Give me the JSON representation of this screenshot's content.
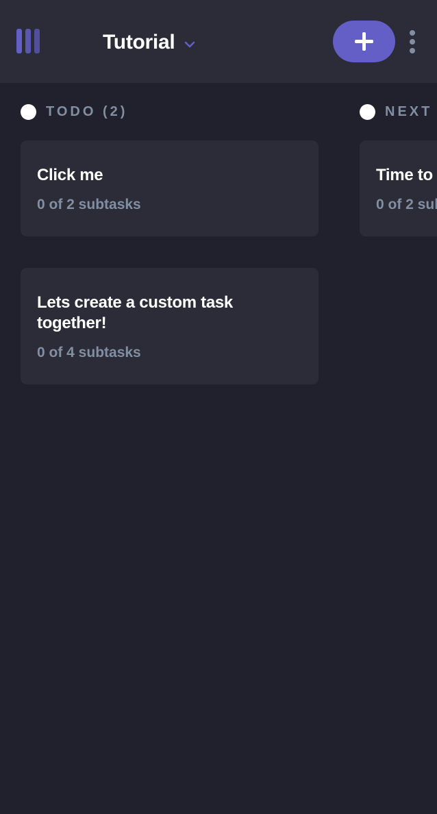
{
  "header": {
    "logo_icon": "kanban-logo-icon",
    "board_title": "Tutorial",
    "board_dropdown_icon": "chevron-down-icon",
    "add_task_icon": "plus-icon",
    "more_icon": "vertical-ellipsis-icon"
  },
  "colors": {
    "background": "#21212d",
    "surface": "#2c2c38",
    "accent": "#635fc7",
    "muted_text": "#828fa3",
    "text": "#ffffff"
  },
  "columns": [
    {
      "label": "TODO (2)",
      "dot_color": "#ffffff",
      "tasks": [
        {
          "title": "Click me",
          "subtasks": "0 of 2 subtasks"
        },
        {
          "title": "Lets create a custom task together!",
          "subtasks": "0 of 4 subtasks"
        }
      ]
    },
    {
      "label": "NEXT (",
      "dot_color": "#ffffff",
      "tasks": [
        {
          "title": "Time to",
          "subtasks": "0 of 2 sul"
        }
      ]
    }
  ]
}
